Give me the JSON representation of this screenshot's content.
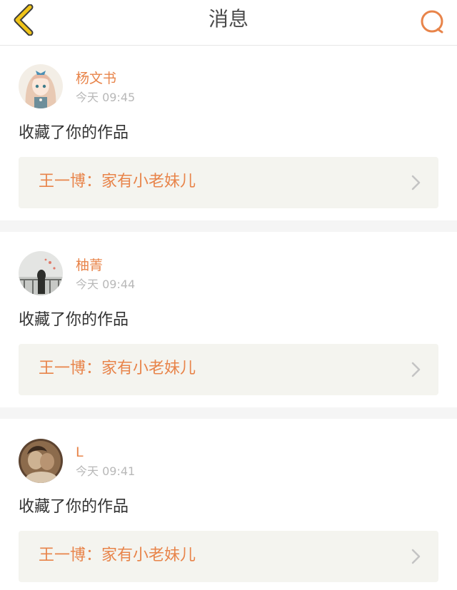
{
  "header": {
    "title": "消息",
    "back_icon": "chevron-left-icon",
    "search_icon": "search-icon",
    "accent_color": "#e8844a",
    "back_color": "#f0c419"
  },
  "messages": [
    {
      "name": "杨文书",
      "time": "今天 09:45",
      "action": "收藏了你的作品",
      "work_title": "王一博：家有小老妹儿"
    },
    {
      "name": "柚菁",
      "time": "今天 09:44",
      "action": "收藏了你的作品",
      "work_title": "王一博：家有小老妹儿"
    },
    {
      "name": "L",
      "time": "今天 09:41",
      "action": "收藏了你的作品",
      "work_title": "王一博：家有小老妹儿"
    }
  ]
}
